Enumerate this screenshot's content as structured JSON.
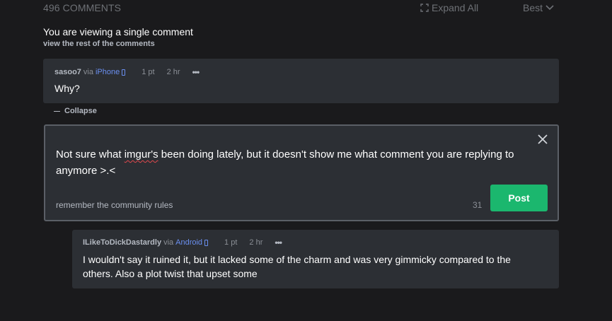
{
  "header": {
    "comments_count": "496 COMMENTS",
    "expand_all": "Expand All",
    "sort": "Best"
  },
  "single": {
    "title": "You are viewing a single comment",
    "view_rest": "view the rest of the comments"
  },
  "comments": [
    {
      "user": "sasoo7",
      "via": "via",
      "device": "iPhone",
      "points": "1 pt",
      "time": "2 hr",
      "more": "•••",
      "text": "Why?"
    },
    {
      "user": "ILikeToDickDastardly",
      "via": "via",
      "device": "Android",
      "points": "1 pt",
      "time": "2 hr",
      "more": "•••",
      "text": "I wouldn't say it ruined it, but it lacked some of the charm and was very gimmicky compared to the others. Also a plot twist that upset some"
    }
  ],
  "collapse_label": "Collapse",
  "reply": {
    "text_before": "Not sure what ",
    "misspelled": "imgur's",
    "text_after": " been doing lately, but it doesn't show me what comment you are replying to anymore >.<",
    "rules": "remember the community rules",
    "char_count": "31",
    "post_label": "Post"
  },
  "colors": {
    "background": "#1a1a1c",
    "card": "#2c2f34",
    "accent_link": "#6a8ff0",
    "post_button": "#1bb76e"
  }
}
